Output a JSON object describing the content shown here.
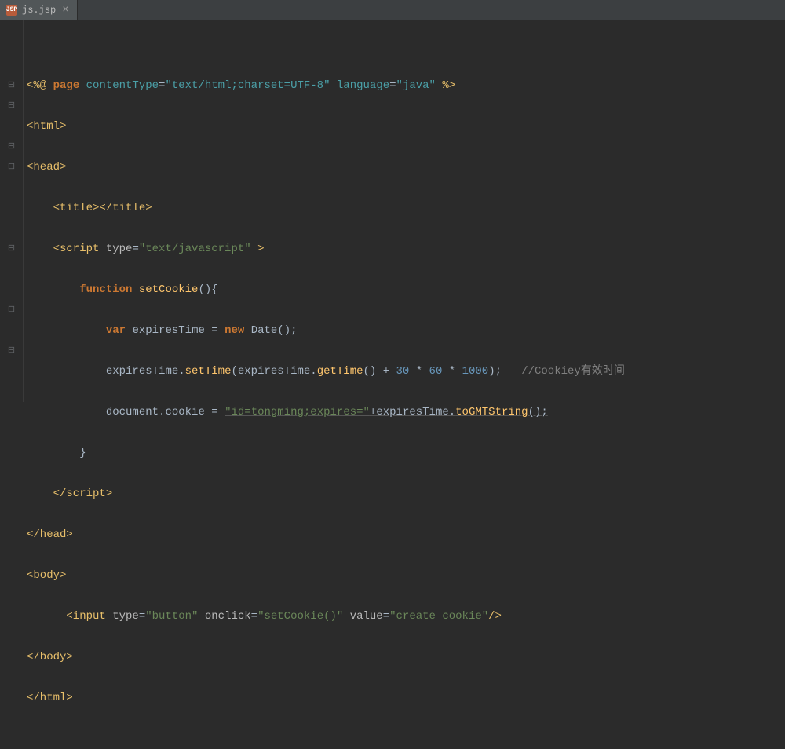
{
  "tab": {
    "icon_label": "JSP",
    "filename": "js.jsp",
    "close": "×"
  },
  "folds": [
    "",
    "⊟",
    "⊟",
    "",
    "⊟",
    "⊟",
    "",
    "",
    "",
    "⊟",
    "",
    "",
    "⊟",
    "",
    "⊟",
    ""
  ],
  "code": {
    "l1_open": "<%@ ",
    "l1_page": "page",
    "l1_sp1": " ",
    "l1_ct": "contentType",
    "l1_eq1": "=",
    "l1_ctval": "\"text/html;charset=UTF-8\"",
    "l1_sp2": " ",
    "l1_lang": "language",
    "l1_eq2": "=",
    "l1_langval": "\"java\"",
    "l1_close": " %>",
    "l2": "<html>",
    "l3": "<head>",
    "l4_open": "    <title>",
    "l4_close": "</title>",
    "l5_a": "    <script ",
    "l5_type": "type",
    "l5_eq": "=",
    "l5_tv": "\"text/javascript\"",
    "l5_b": " >",
    "l6_pad": "        ",
    "l6_fn": "function",
    "l6_sp": " ",
    "l6_name": "setCookie",
    "l6_par": "(){",
    "l7_pad": "            ",
    "l7_var": "var",
    "l7_sp1": " ",
    "l7_id": "expiresTime",
    "l7_sp2": " = ",
    "l7_new": "new",
    "l7_sp3": " ",
    "l7_date": "Date",
    "l7_end": "();",
    "l8_pad": "            ",
    "l8_a": "expiresTime.",
    "l8_st": "setTime",
    "l8_b": "(expiresTime.",
    "l8_gt": "getTime",
    "l8_c": "() + ",
    "l8_n1": "30",
    "l8_m1": " * ",
    "l8_n2": "60",
    "l8_m2": " * ",
    "l8_n3": "1000",
    "l8_d": ");   ",
    "l8_cm": "//Cookiey有效时间",
    "l9_pad": "            ",
    "l9_a": "document.",
    "l9_ck": "cookie",
    "l9_eq": " = ",
    "l9_s1": "\"id=tongming;expires=\"",
    "l9_plus": "+expiresTime.",
    "l9_gmt": "toGMTString",
    "l9_end": "();",
    "l10": "        }",
    "l11": "    </script>",
    "l12": "</head>",
    "l13": "<body>",
    "l14_a": "      <input ",
    "l14_type": "type",
    "l14_eq1": "=",
    "l14_tv": "\"button\"",
    "l14_sp1": " ",
    "l14_oc": "onclick",
    "l14_eq2": "=",
    "l14_ov": "\"setCookie()\"",
    "l14_sp2": " ",
    "l14_val": "value",
    "l14_eq3": "=",
    "l14_vv": "\"create cookie\"",
    "l14_b": "/>",
    "l15": "</body>",
    "l16": "</html>"
  }
}
